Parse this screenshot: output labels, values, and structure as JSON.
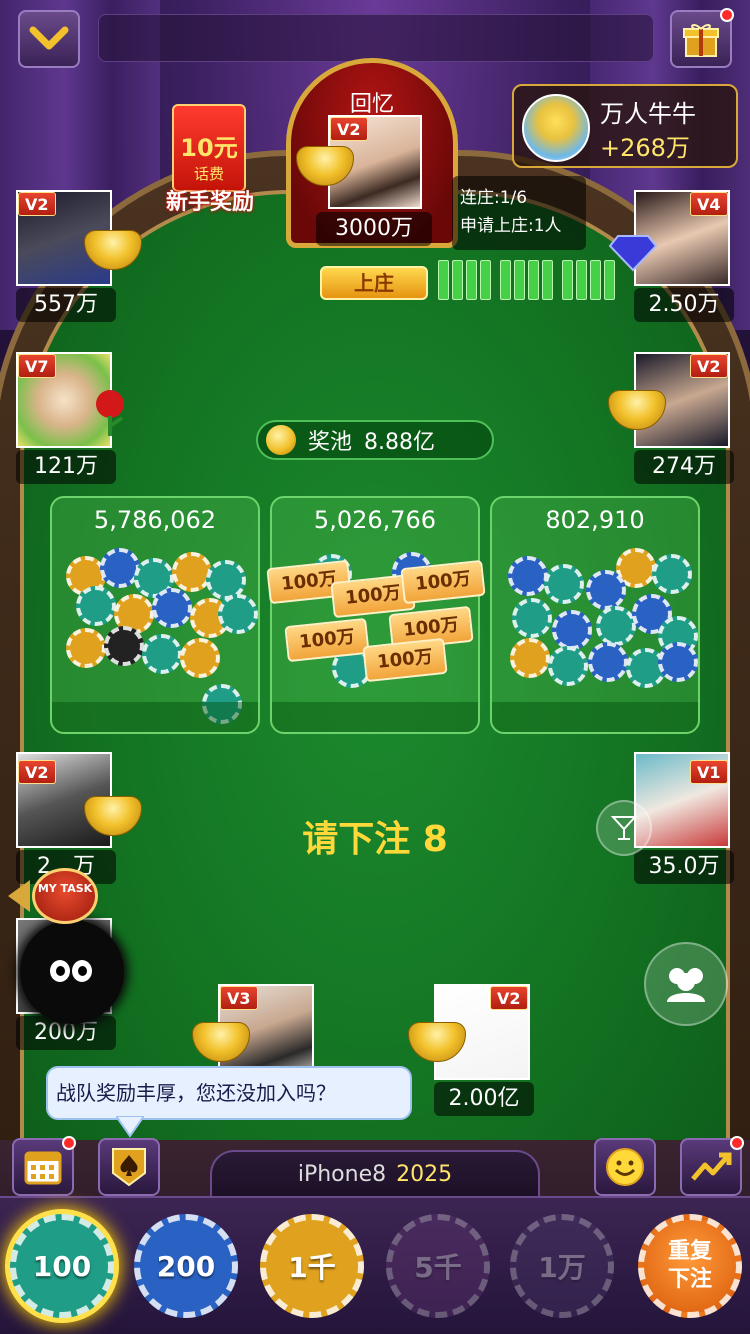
{
  "banker": {
    "name": "回忆",
    "vip": "V2",
    "coins": "3000万"
  },
  "banker_info": {
    "streak": "连庄:1/6",
    "queue": "申请上庄:1人"
  },
  "up_button": "上庄",
  "me": {
    "name": "万人牛牛",
    "score": "+268万"
  },
  "reward": {
    "amount": "10元",
    "sub": "话费",
    "label": "新手奖励"
  },
  "seats": {
    "left1": {
      "vip": "V2",
      "coins": "557万"
    },
    "left2": {
      "vip": "V7",
      "coins": "121万"
    },
    "left3": {
      "vip": "V2",
      "coins": "2__万"
    },
    "left4": {
      "coins": "200万"
    },
    "right1": {
      "vip": "V4",
      "coins": "2.50万"
    },
    "right2": {
      "vip": "V2",
      "coins": "274万"
    },
    "right3": {
      "vip": "V1",
      "coins": "35.0万"
    },
    "bottom1": {
      "vip": "V3"
    },
    "bottom2": {
      "vip": "V2",
      "coins": "2.00亿"
    }
  },
  "pool": {
    "label": "奖池",
    "value": "8.88亿"
  },
  "bet_areas": [
    {
      "total": "5,786,062"
    },
    {
      "total": "5,026,766",
      "bill_label": "100万"
    },
    {
      "total": "802,910"
    }
  ],
  "prompt": "请下注  8",
  "task_label": "MY TASK",
  "chat": "战队奖励丰厚，您还没加入吗？",
  "device": {
    "name": "iPhone8",
    "year": "2025"
  },
  "bet_chips": [
    {
      "label": "100",
      "color": "#1f9d86",
      "selected": true
    },
    {
      "label": "200",
      "color": "#2a62c4",
      "selected": false
    },
    {
      "label": "1千",
      "color": "#e0a21e",
      "selected": false
    },
    {
      "label": "5千",
      "color": "#6a3a7a",
      "selected": false,
      "disabled": true
    },
    {
      "label": "1万",
      "color": "#4a3a6a",
      "selected": false,
      "disabled": true
    }
  ],
  "rebet": {
    "line1": "重复",
    "line2": "下注"
  }
}
